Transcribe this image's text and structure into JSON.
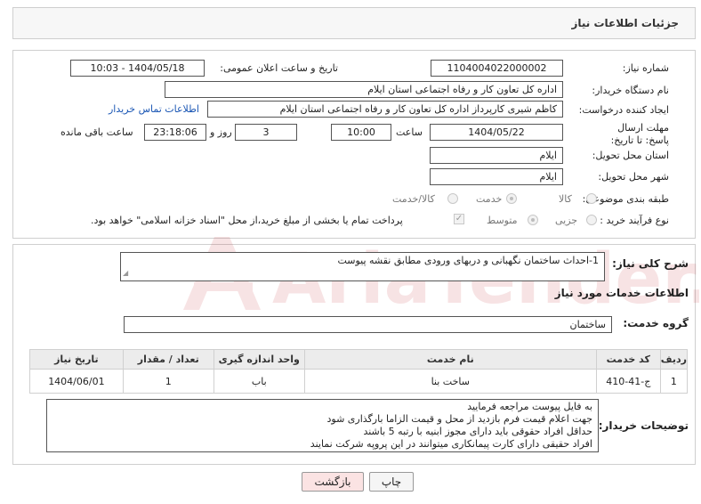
{
  "header": {
    "title": "جزئیات اطلاعات نیاز"
  },
  "form": {
    "need_number": {
      "label": "شماره نیاز:",
      "value": "1104004022000002"
    },
    "announce_datetime": {
      "label": "تاریخ و ساعت اعلان عمومی:",
      "value": "1404/05/18 - 10:03"
    },
    "buyer_org": {
      "label": "نام دستگاه خریدار:",
      "value": "اداره کل تعاون  کار و رفاه اجتماعی استان ایلام"
    },
    "requester": {
      "label": "ایجاد کننده درخواست:",
      "value": "کاظم شیری کارپرداز اداره کل تعاون  کار و رفاه اجتماعی استان ایلام",
      "contact_link": "اطلاعات تماس خریدار"
    },
    "deadline": {
      "label": "مهلت ارسال پاسخ: تا تاریخ:",
      "date": "1404/05/22",
      "time_label": "ساعت",
      "time": "10:00",
      "days": "3",
      "days_label": "روز و",
      "remaining": "23:18:06",
      "remaining_label": "ساعت باقی مانده"
    },
    "province": {
      "label": "استان محل تحویل:",
      "value": "ایلام"
    },
    "city": {
      "label": "شهر محل تحویل:",
      "value": "ایلام"
    },
    "category": {
      "label": "طبقه بندی موضوعی:",
      "options": [
        "کالا",
        "خدمت",
        "کالا/خدمت"
      ],
      "selected": "خدمت"
    },
    "process": {
      "label": "نوع فرآیند خرید :",
      "options": [
        "جزیی",
        "متوسط"
      ],
      "selected": "متوسط",
      "payment_note": "پرداخت تمام یا بخشی از مبلغ خرید،از محل \"اسناد خزانه اسلامی\" خواهد بود."
    }
  },
  "summary": {
    "label": "شرح کلی نیاز:",
    "value": "1-احداث ساختمان نگهبانی و دربهای ورودی مطابق نقشه پیوست"
  },
  "services": {
    "section_title": "اطلاعات خدمات مورد نیاز",
    "group_label": "گروه خدمت:",
    "group_value": "ساختمان",
    "columns": [
      "ردیف",
      "کد خدمت",
      "نام خدمت",
      "واحد اندازه گیری",
      "تعداد / مقدار",
      "تاریخ نیاز"
    ],
    "rows": [
      {
        "row": "1",
        "code": "ج-41-410",
        "name": "ساخت بنا",
        "unit": "باب",
        "qty": "1",
        "date": "1404/06/01"
      }
    ]
  },
  "buyer_notes": {
    "label": "توضیحات خریدار:",
    "lines": [
      "به فایل پیوست مراجعه فرمایید",
      "جهت اعلام قیمت فرم بازدید از محل و قیمت الزاما بارگذاری شود",
      "حداقل افراد حقوقی باید دارای مجوز ابنیه با رتبه 5 باشند",
      "افراد حقیقی دارای کارت پیمانکاری میتوانند در این پروپه شرکت نمایند"
    ]
  },
  "buttons": {
    "print": "چاپ",
    "back": "بازگشت"
  },
  "watermark": {
    "text": "AriaTender.neT"
  }
}
